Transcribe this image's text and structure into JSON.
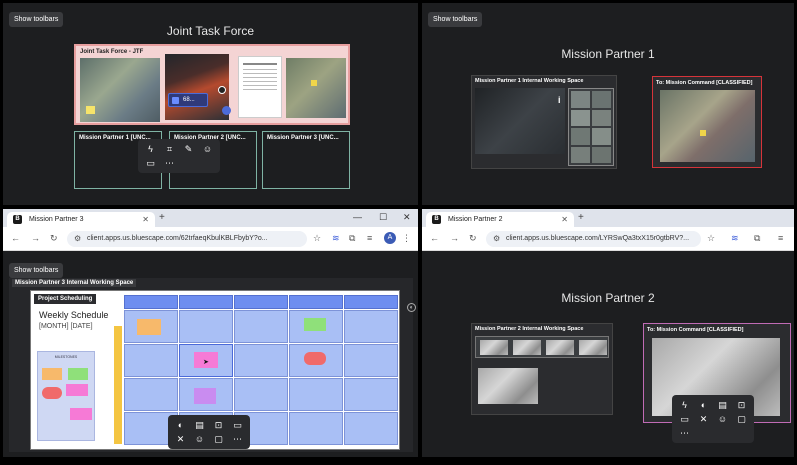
{
  "common": {
    "show_toolbars": "Show toolbars"
  },
  "top_left": {
    "title": "Joint Task Force",
    "jtf_frame_label": "Joint Task Force - JTF",
    "selected_badge": "68...",
    "partner_frames": [
      "Mission Partner 1 [UNC...",
      "Mission Partner 2 [UNC...",
      "Mission Partner 3 [UNC..."
    ],
    "toolbar_icons": [
      "lightning-icon",
      "crop-icon",
      "pin-icon",
      "smiley-icon",
      "comment-icon",
      "more-icon"
    ]
  },
  "top_right": {
    "title": "Mission Partner 1",
    "working_space_label": "Mission Partner 1 Internal Working Space",
    "classified_label": "To: Mission Command [CLASSIFIED]"
  },
  "bottom_left": {
    "tab_title": "Mission Partner 3",
    "url": "client.apps.us.bluescape.com/62trfaeqKbulKBLFbybY?o...",
    "working_space_label": "Mission Partner 3 Internal Working Space",
    "section_label": "Project Scheduling",
    "schedule_title": "Weekly Schedule",
    "schedule_subtitle": "[MONTH] [DATE]",
    "milestones_label": "MILESTONES",
    "avatar_letter": "A"
  },
  "bottom_right": {
    "tab_title": "Mission Partner 2",
    "url": "client.apps.us.bluescape.com/LYRSwQa3txX15r0gtbRV?...",
    "title": "Mission Partner 2",
    "working_space_label": "Mission Partner 2 Internal Working Space",
    "classified_label": "To: Mission Command [CLASSIFIED]"
  },
  "colors": {
    "frame_teal": "#7fb3a4",
    "classified_red": "#d6343a",
    "classified_purple": "#c06bb5",
    "jtf_pink": "#f4d4d4",
    "grid_blue": "#a9bff5"
  }
}
